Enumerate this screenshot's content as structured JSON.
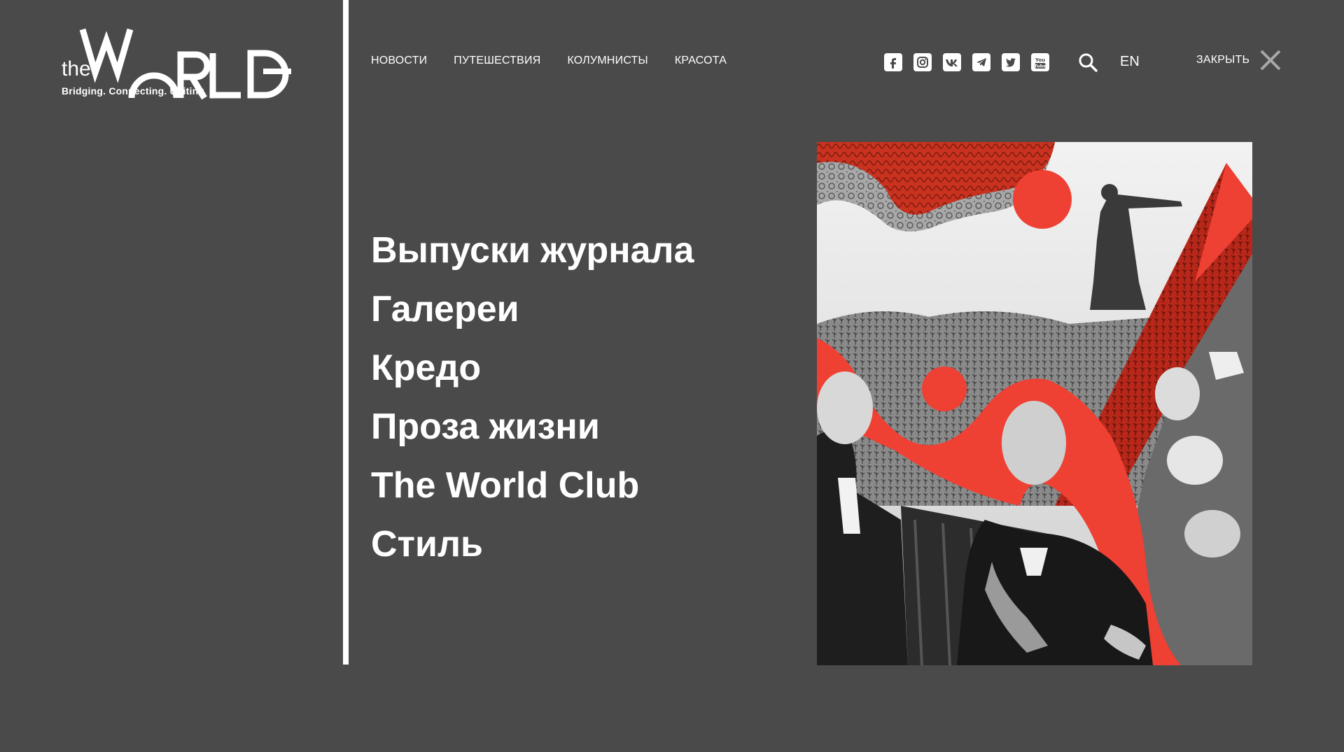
{
  "logo": {
    "prefix": "the",
    "wordmark": "WORLD",
    "tagline": "Bridging. Connecting. Uniting"
  },
  "topnav": {
    "items": [
      {
        "label": "НОВОСТИ"
      },
      {
        "label": "ПУТЕШЕСТВИЯ"
      },
      {
        "label": "КОЛУМНИСТЫ"
      },
      {
        "label": "КРАСОТА"
      }
    ]
  },
  "socials": [
    {
      "icon": "facebook-icon",
      "glyph": "f"
    },
    {
      "icon": "instagram-icon",
      "glyph": ""
    },
    {
      "icon": "vk-icon",
      "glyph": "vk"
    },
    {
      "icon": "telegram-icon",
      "glyph": ""
    },
    {
      "icon": "twitter-icon",
      "glyph": ""
    },
    {
      "icon": "youtube-icon",
      "glyph": "You Tube"
    }
  ],
  "lang": "EN",
  "close": {
    "label": "ЗАКРЫТЬ"
  },
  "menu": {
    "items": [
      {
        "label": "Выпуски журнала"
      },
      {
        "label": "Галереи"
      },
      {
        "label": "Кредо"
      },
      {
        "label": "Проза жизни"
      },
      {
        "label": "The World Club"
      },
      {
        "label": "Стиль"
      }
    ]
  },
  "colors": {
    "background": "#4a4a4b",
    "accent": "#ee4033",
    "text": "#ffffff"
  }
}
